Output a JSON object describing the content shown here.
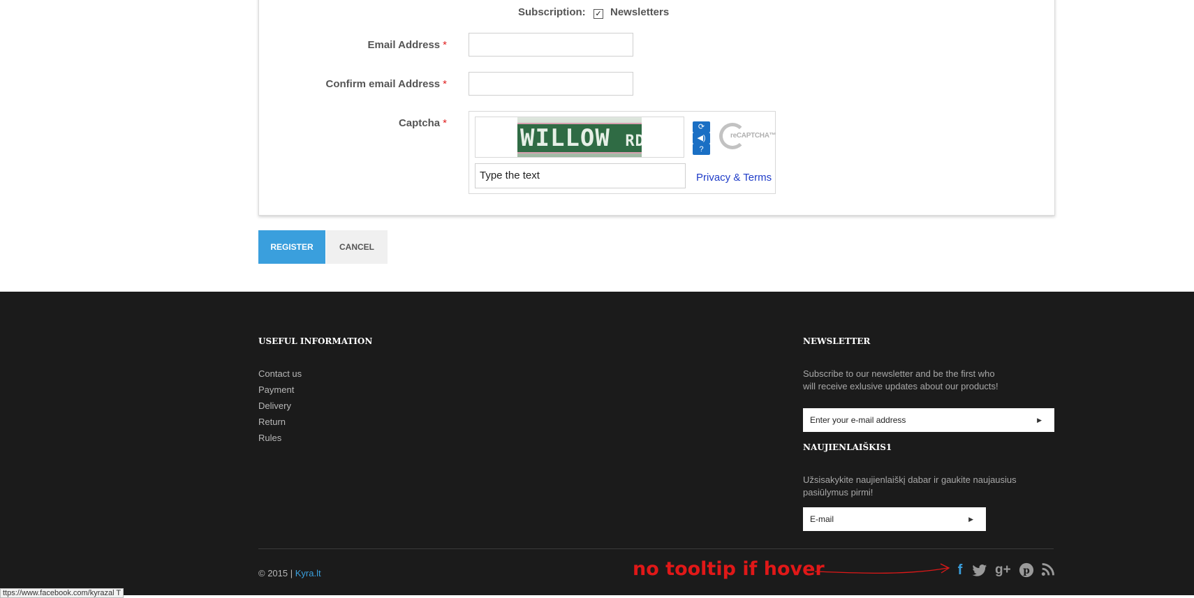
{
  "form": {
    "subscription_label": "Subscription:",
    "newsletters_label": "Newsletters",
    "newsletters_checked": true,
    "email_label": "Email Address",
    "confirm_email_label": "Confirm email Address",
    "captcha_label": "Captcha",
    "required_mark": "*",
    "email_value": "",
    "confirm_email_value": ""
  },
  "captcha": {
    "image_text": "WILLOW",
    "image_text_small": "RD",
    "input_placeholder": "Type the text",
    "privacy_link": "Privacy & Terms",
    "logo_text": "reCAPTCHA™",
    "buttons": [
      "refresh-icon",
      "audio-icon",
      "help-icon"
    ]
  },
  "actions": {
    "register": "REGISTER",
    "cancel": "CANCEL"
  },
  "footer": {
    "useful_title": "USEFUL INFORMATION",
    "links": [
      "Contact us",
      "Payment",
      "Delivery",
      "Return",
      "Rules"
    ],
    "newsletter_title": "NEWSLETTER",
    "newsletter_text": "Subscribe to our newsletter and be the first who will receive exlusive updates about our products!",
    "newsletter_placeholder": "Enter your e-mail address",
    "newsletter2_title": "NAUJIENLAIŠKIS1",
    "newsletter2_text": "Užsisakykite naujienlaiškį dabar ir gaukite naujausius pasiūlymus pirmi!",
    "newsletter2_placeholder": "E-mail",
    "copyright": "© 2015 |",
    "brand": "Kyra.lt",
    "social": [
      "facebook-icon",
      "twitter-icon",
      "google-plus-icon",
      "pinterest-icon",
      "rss-icon"
    ]
  },
  "annotation": {
    "text": "no tooltip if hover"
  },
  "status_bar": {
    "url": "ttps://www.facebook.com/kyrazal T"
  },
  "colors": {
    "accent": "#3a9fdd",
    "footer_bg": "#1b1b1b",
    "annotation": "#e01818",
    "required": "#e02020"
  }
}
